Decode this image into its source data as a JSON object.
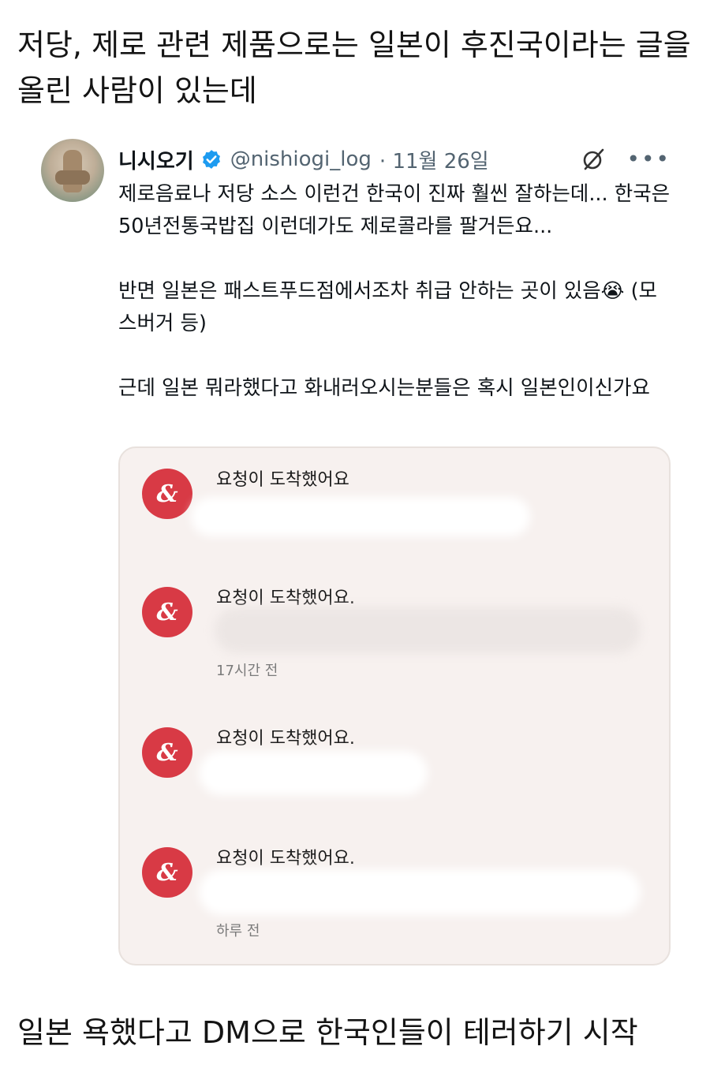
{
  "caption": {
    "top": "저당, 제로 관련 제품으로는 일본이 후진국이라는 글을 올린 사람이 있는데",
    "bottom": "일본 욕했다고 DM으로 한국인들이 테러하기 시작"
  },
  "tweet": {
    "display_name": "니시오기",
    "handle": "@nishiogi_log",
    "date": "· 11월 26일",
    "body": [
      "제로음료나 저당 소스 이런건 한국이 진짜 훨씬 잘하는데... 한국은 50년전통국밥집 이런데가도 제로콜라를 팔거든요...",
      "",
      "반면 일본은 패스트푸드점에서조차 취급 안하는 곳이 있음😭 (모스버거 등)",
      "",
      "근데 일본 뭐라했다고 화내러오시는분들은 혹시 일본인이신가요"
    ]
  },
  "dm_notifications": [
    {
      "title": "요청이 도착했어요",
      "time": ""
    },
    {
      "title": "요청이 도착했어요.",
      "time": "17시간 전"
    },
    {
      "title": "요청이 도착했어요.",
      "time": ""
    },
    {
      "title": "요청이 도착했어요.",
      "time": "하루 전"
    }
  ],
  "icons": {
    "verified": "verified-badge-icon",
    "grok": "grok-icon",
    "more": "more-options-icon",
    "app_logo": "app-logo-icon"
  },
  "colors": {
    "verified_blue": "#1d9bf0",
    "app_red": "#d83a45",
    "card_bg": "#f7f1ef"
  }
}
